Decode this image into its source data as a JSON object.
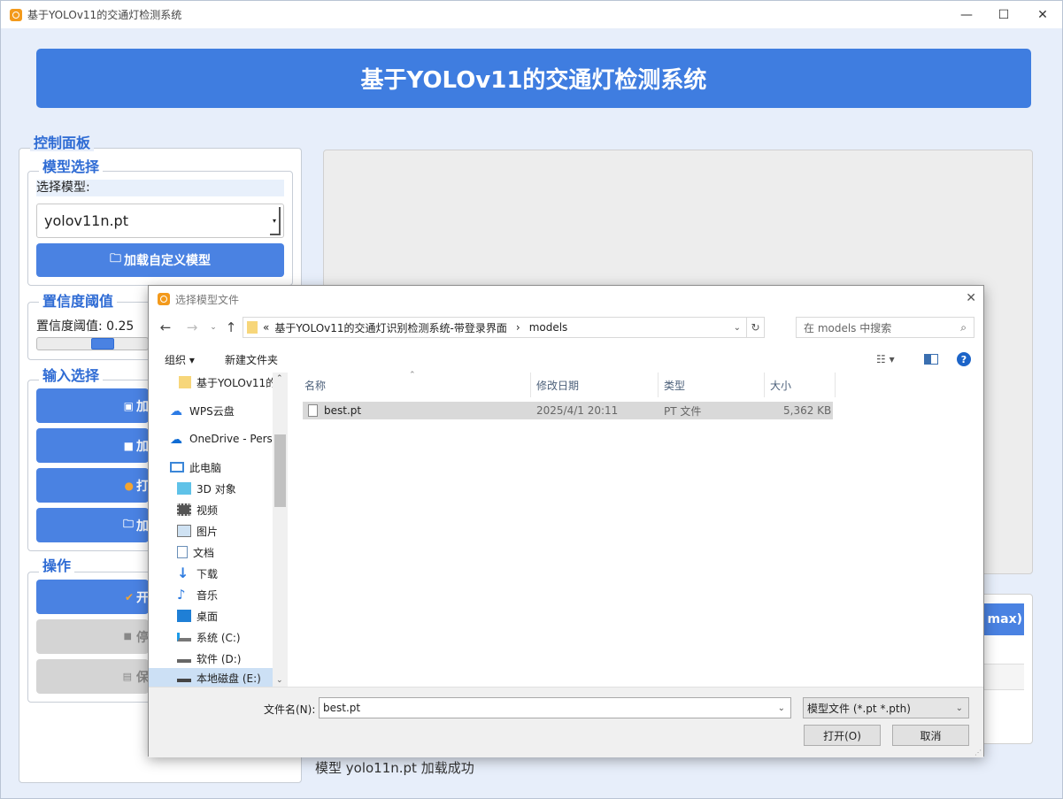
{
  "window": {
    "title": "基于YOLOv11的交通灯检测系统"
  },
  "header": {
    "title": "基于YOLOv11的交通灯检测系统"
  },
  "control_panel": {
    "title": "控制面板",
    "model_group": {
      "title": "模型选择",
      "label": "选择模型:",
      "selected": "yolov11n.pt",
      "load_button": "加载自定义模型"
    },
    "confidence_group": {
      "title": "置信度阈值",
      "label": "置信度阈值: 0.25",
      "value": 0.25
    },
    "input_group": {
      "title": "输入选择",
      "buttons": [
        "加",
        "加",
        "打",
        "加"
      ]
    },
    "ops_group": {
      "title": "操作",
      "buttons": [
        "开",
        "停",
        "保"
      ]
    }
  },
  "table": {
    "partial_header": "max)"
  },
  "status": {
    "text": "模型 yolo11n.pt 加载成功"
  },
  "dialog": {
    "title": "选择模型文件",
    "address": {
      "prefix": "«",
      "crumb1": "基于YOLOv11的交通灯识别检测系统-带登录界面",
      "sep": "›",
      "crumb2": "models"
    },
    "search_placeholder": "在 models 中搜索",
    "toolbar": {
      "organize": "组织 ▾",
      "new_folder": "新建文件夹"
    },
    "nav_items": [
      {
        "label": "基于YOLOv11的",
        "icon": "folder-icon"
      },
      {
        "label": "WPS云盘",
        "icon": "cloud-icon"
      },
      {
        "label": "OneDrive - Perso",
        "icon": "onedrive-icon"
      },
      {
        "label": "此电脑",
        "icon": "computer-icon"
      },
      {
        "label": "3D 对象",
        "icon": "cube-icon"
      },
      {
        "label": "视频",
        "icon": "video-icon"
      },
      {
        "label": "图片",
        "icon": "picture-icon"
      },
      {
        "label": "文档",
        "icon": "document-icon"
      },
      {
        "label": "下载",
        "icon": "download-icon"
      },
      {
        "label": "音乐",
        "icon": "music-icon"
      },
      {
        "label": "桌面",
        "icon": "desktop-icon"
      },
      {
        "label": "系统 (C:)",
        "icon": "drive-c-icon"
      },
      {
        "label": "软件 (D:)",
        "icon": "drive-icon"
      },
      {
        "label": "本地磁盘 (E:)",
        "icon": "drive-icon"
      }
    ],
    "columns": [
      "名称",
      "修改日期",
      "类型",
      "大小"
    ],
    "files": [
      {
        "name": "best.pt",
        "date": "2025/4/1 20:11",
        "type": "PT 文件",
        "size": "5,362 KB"
      }
    ],
    "filename_label": "文件名(N):",
    "filename_value": "best.pt",
    "filter": "模型文件 (*.pt *.pth)",
    "open_button": "打开(O)",
    "cancel_button": "取消"
  }
}
